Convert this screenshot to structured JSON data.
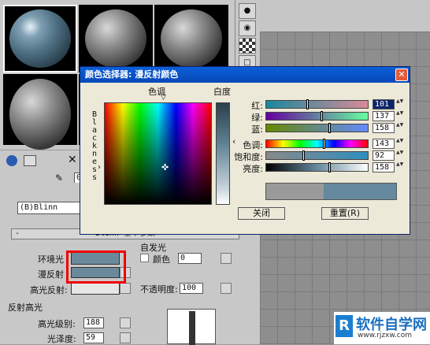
{
  "dialog": {
    "title": "颜色选择器: 漫反射颜色",
    "hue_label": "色调",
    "whiteness_label": "白度",
    "blackness_label": "Blackness",
    "close_button": "关闭",
    "reset_button": "重置(R)",
    "sliders": [
      {
        "label": "红:",
        "value": "101",
        "fraction": 0.4
      },
      {
        "label": "绿:",
        "value": "137",
        "fraction": 0.54
      },
      {
        "label": "蓝:",
        "value": "158",
        "fraction": 0.62
      },
      {
        "label": "色调:",
        "value": "143",
        "fraction": 0.56
      },
      {
        "label": "饱和度:",
        "value": "92",
        "fraction": 0.36
      },
      {
        "label": "亮度:",
        "value": "158",
        "fraction": 0.62
      }
    ],
    "old_color": "#9a9a9a",
    "new_color": "#65899e"
  },
  "material": {
    "shader_dropdown": "(B)Blinn",
    "basic_params_title": "Blinn 基本参数",
    "self_illum_title": "自发光",
    "color_checkbox_label": "颜色",
    "self_illum_value": "0",
    "ambient_label": "环境光",
    "diffuse_label": "漫反射",
    "specular_label": "高光反射:",
    "opacity_label": "不透明度:",
    "opacity_value": "100",
    "spec_highlights_title": "反射高光",
    "spec_level_label": "高光级别:",
    "spec_level_value": "188",
    "glossiness_label": "光泽度:",
    "glossiness_value": "59",
    "ambient_color": "#6a8a9c",
    "diffuse_color": "#6a8a9c",
    "specular_color": "#e6e6e6"
  },
  "toolbar": {
    "field_value": "01"
  },
  "watermark": {
    "text": "软件自学网",
    "url": "www.rjzxw.com"
  }
}
